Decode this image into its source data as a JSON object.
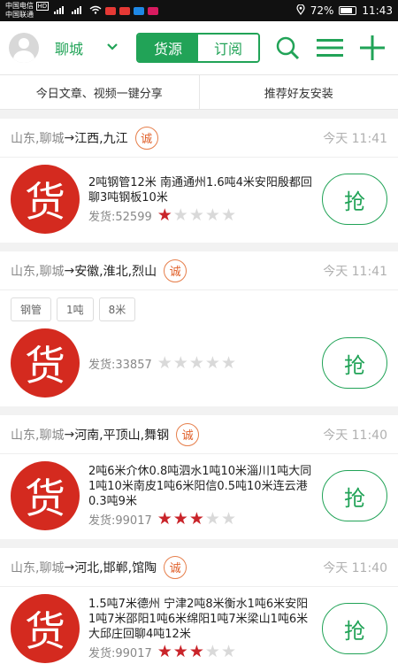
{
  "status_bar": {
    "carrier1": "中国电信",
    "carrier1_badge": "HD",
    "carrier2": "中国联通",
    "signal_icons": [
      "signal-4g-icon",
      "signal-5g-icon",
      "wifi-icon"
    ],
    "battery": "72%",
    "time": "11:43",
    "colors": {
      "app1": "#e53935",
      "app2": "#e53935",
      "app3": "#1e88e5",
      "app4": "#d81b60"
    }
  },
  "header": {
    "city": "聊城",
    "tabs": [
      {
        "label": "货源",
        "active": true
      },
      {
        "label": "订阅",
        "active": false
      }
    ],
    "icons": [
      "search-icon",
      "menu-icon",
      "add-icon"
    ],
    "accent": "#21a357"
  },
  "actions": {
    "share": "今日文章、视频一键分享",
    "recommend": "推荐好友安装"
  },
  "listings": [
    {
      "from": "山东,聊城",
      "arrow": "→",
      "to": "江西,九江",
      "badge": "诚",
      "time": "今天 11:41",
      "tags": [],
      "desc": "2吨钢管12米 南通通州1.6吨4米安阳殷都回聊3吨钢板10米",
      "ship": "发货:52599",
      "rating": 1,
      "avatar": "货",
      "grab": "抢"
    },
    {
      "from": "山东,聊城",
      "arrow": "→",
      "to": "安徽,淮北,烈山",
      "badge": "诚",
      "time": "今天 11:41",
      "tags": [
        "钢管",
        "1吨",
        "8米"
      ],
      "desc": "",
      "ship": "发货:33857",
      "rating": 0,
      "avatar": "货",
      "grab": "抢"
    },
    {
      "from": "山东,聊城",
      "arrow": "→",
      "to": "河南,平顶山,舞钢",
      "badge": "诚",
      "time": "今天 11:40",
      "tags": [],
      "desc": "2吨6米介休0.8吨泗水1吨10米淄川1吨大同1吨10米南皮1吨6米阳信0.5吨10米连云港0.3吨9米",
      "ship": "发货:99017",
      "rating": 3,
      "avatar": "货",
      "grab": "抢"
    },
    {
      "from": "山东,聊城",
      "arrow": "→",
      "to": "河北,邯郸,馆陶",
      "badge": "诚",
      "time": "今天 11:40",
      "tags": [],
      "desc": "1.5吨7米德州 宁津2吨8米衡水1吨6米安阳1吨7米邵阳1吨6米绵阳1吨7米梁山1吨6米大邱庄回聊4吨12米",
      "ship": "发货:99017",
      "rating": 3,
      "avatar": "货",
      "grab": "抢"
    }
  ]
}
